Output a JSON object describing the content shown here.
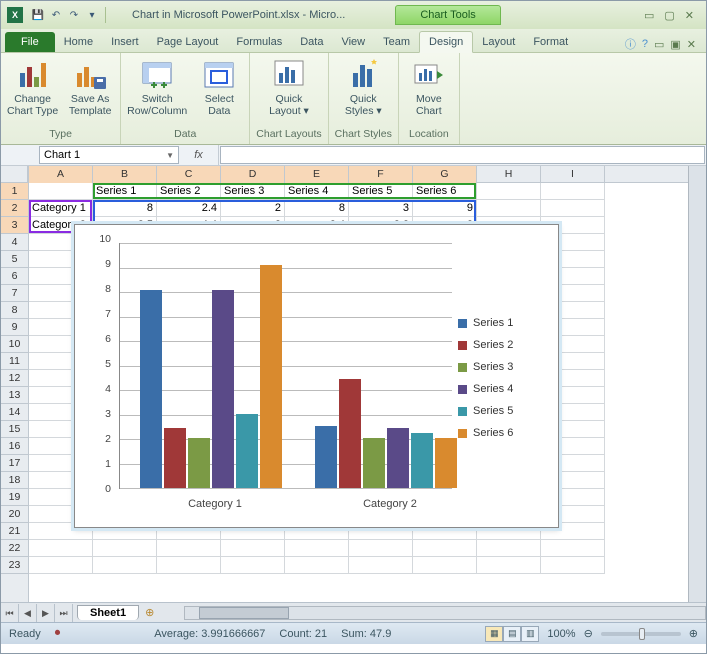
{
  "window": {
    "title_full": "Chart in Microsoft PowerPoint.xlsx - Micro...",
    "context_tab": "Chart Tools"
  },
  "tabs": {
    "file": "File",
    "home": "Home",
    "insert": "Insert",
    "page_layout": "Page Layout",
    "formulas": "Formulas",
    "data": "Data",
    "view": "View",
    "team": "Team",
    "design": "Design",
    "layout": "Layout",
    "format": "Format"
  },
  "ribbon": {
    "change_chart_type": "Change\nChart Type",
    "save_as_template": "Save As\nTemplate",
    "switch_row_col": "Switch\nRow/Column",
    "select_data": "Select\nData",
    "quick_layout": "Quick\nLayout ▾",
    "quick_styles": "Quick\nStyles ▾",
    "move_chart": "Move\nChart",
    "group_type": "Type",
    "group_data": "Data",
    "group_layouts": "Chart Layouts",
    "group_styles": "Chart Styles",
    "group_location": "Location"
  },
  "namebox": "Chart 1",
  "fx_label": "fx",
  "columns": [
    "A",
    "B",
    "C",
    "D",
    "E",
    "F",
    "G",
    "H",
    "I"
  ],
  "row_count": 23,
  "grid": {
    "headers": [
      "",
      "Series 1",
      "Series 2",
      "Series 3",
      "Series 4",
      "Series 5",
      "Series 6"
    ],
    "rows": [
      [
        "Category 1",
        "8",
        "2.4",
        "2",
        "8",
        "3",
        "9"
      ],
      [
        "Category 2",
        "2.5",
        "4.4",
        "2",
        "2.4",
        "2.2",
        "2"
      ]
    ]
  },
  "chart_data": {
    "type": "bar",
    "categories": [
      "Category 1",
      "Category 2"
    ],
    "series": [
      {
        "name": "Series 1",
        "values": [
          8,
          2.5
        ],
        "color": "#3a6ea8"
      },
      {
        "name": "Series 2",
        "values": [
          2.4,
          4.4
        ],
        "color": "#a03838"
      },
      {
        "name": "Series 3",
        "values": [
          2,
          2
        ],
        "color": "#7b9a45"
      },
      {
        "name": "Series 4",
        "values": [
          8,
          2.4
        ],
        "color": "#5a4a88"
      },
      {
        "name": "Series 5",
        "values": [
          3,
          2.2
        ],
        "color": "#3a98a8"
      },
      {
        "name": "Series 6",
        "values": [
          9,
          2
        ],
        "color": "#d98a2e"
      }
    ],
    "ylim": [
      0,
      10
    ],
    "yticks": [
      0,
      1,
      2,
      3,
      4,
      5,
      6,
      7,
      8,
      9,
      10
    ]
  },
  "sheet_tab": "Sheet1",
  "status": {
    "ready": "Ready",
    "average_label": "Average:",
    "average": "3.991666667",
    "count_label": "Count:",
    "count": "21",
    "sum_label": "Sum:",
    "sum": "47.9",
    "zoom": "100%"
  }
}
